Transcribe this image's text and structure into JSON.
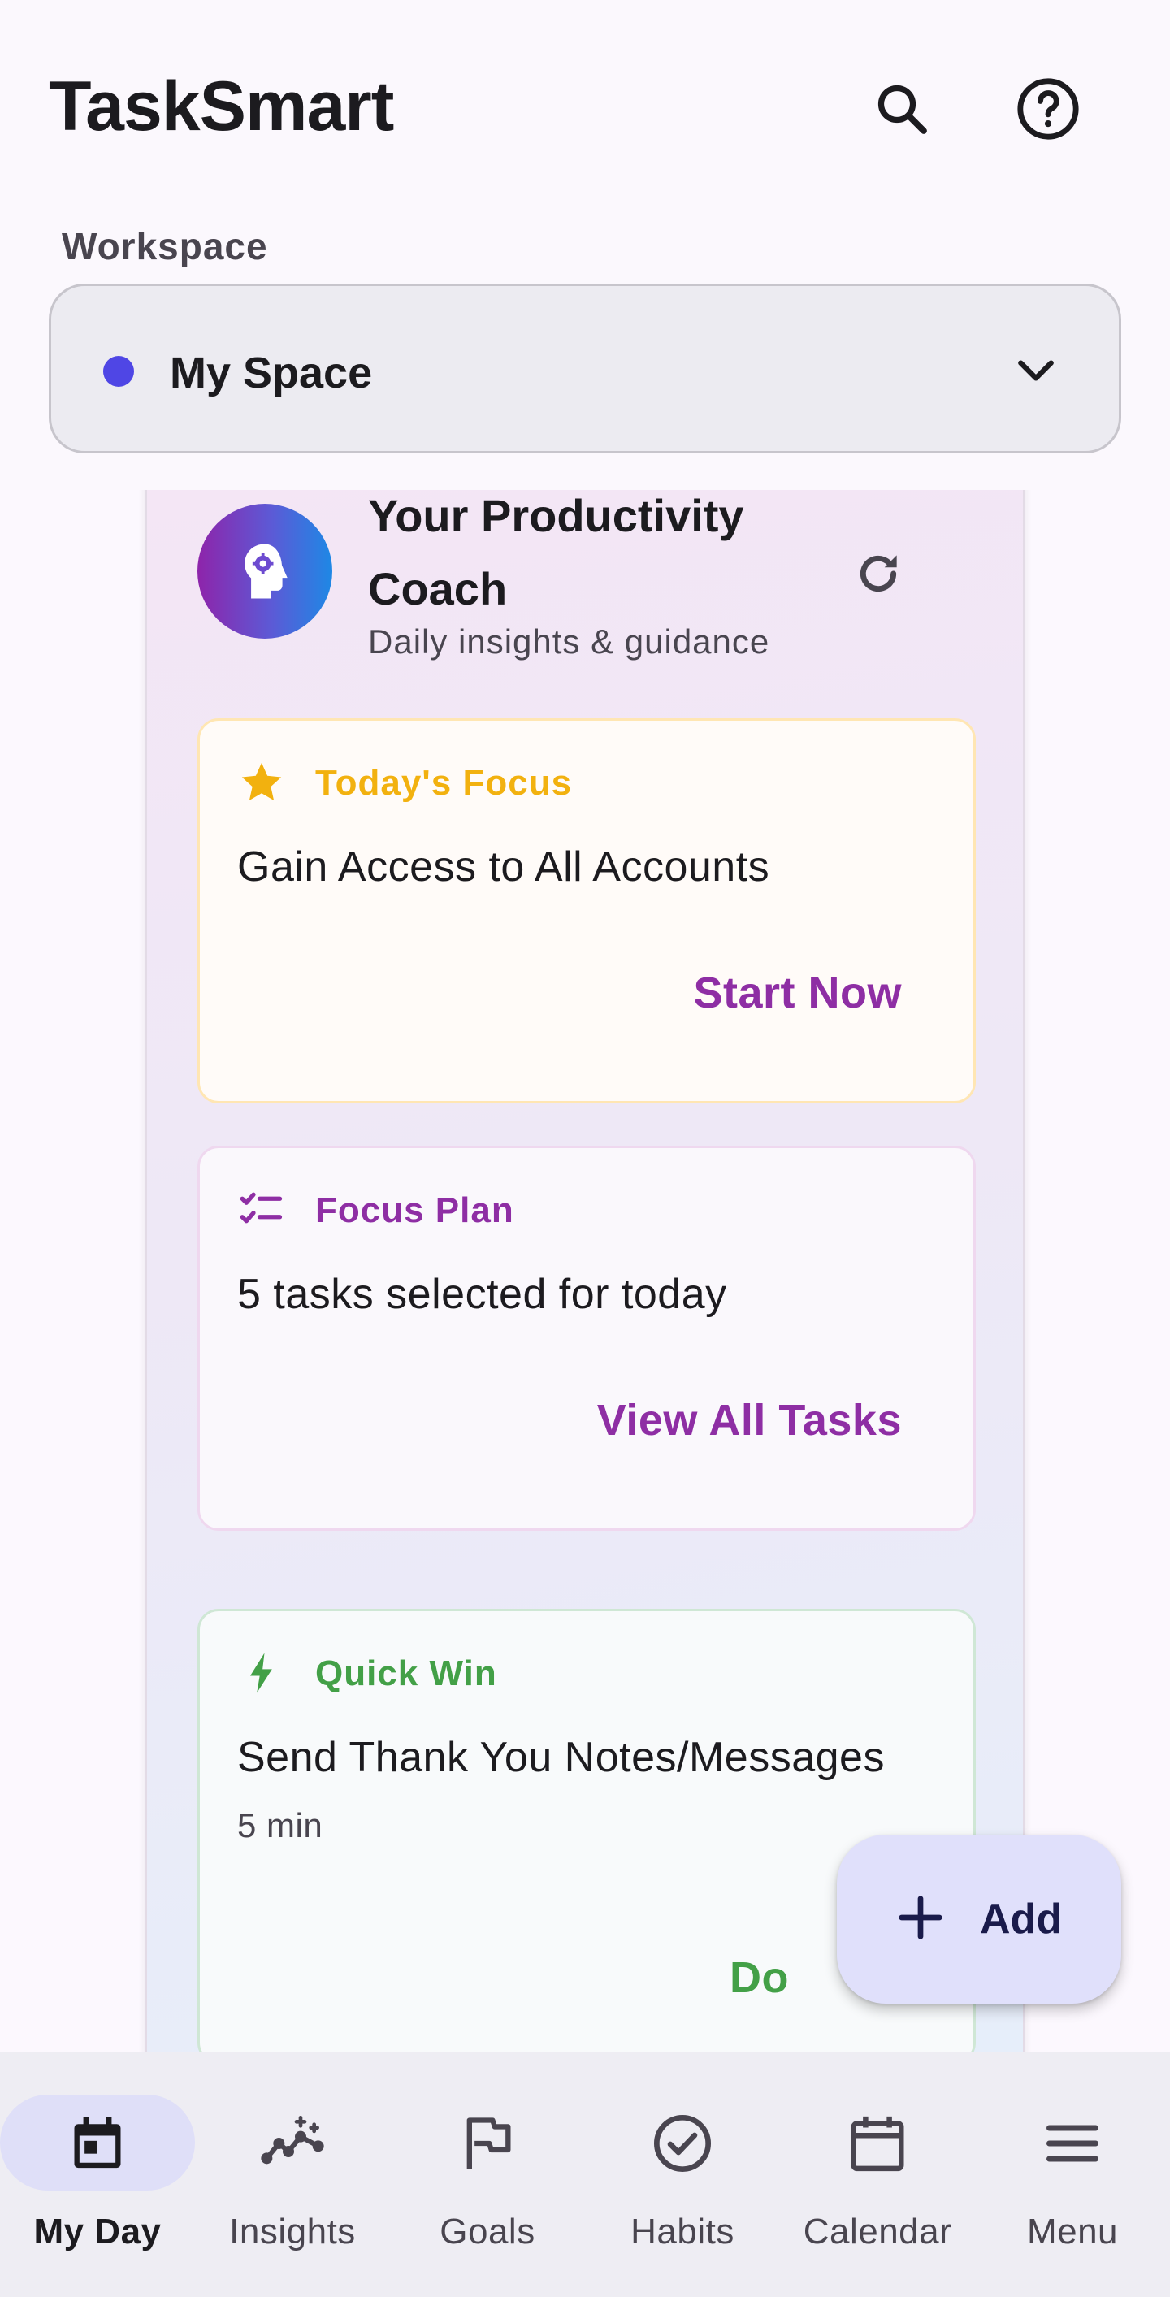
{
  "app": {
    "title": "TaskSmart"
  },
  "header": {
    "search_icon": "search-icon",
    "help_icon": "help-icon"
  },
  "workspace": {
    "label": "Workspace",
    "selected": "My Space",
    "dot_color": "#4f46e5"
  },
  "coach": {
    "title": "Your Productivity Coach",
    "subtitle": "Daily insights & guidance",
    "cards": [
      {
        "label": "Today's Focus",
        "text": "Gain Access to All Accounts",
        "action": "Start Now",
        "color": "#f2b10f",
        "icon": "star-icon"
      },
      {
        "label": "Focus Plan",
        "text": "5 tasks selected for today",
        "action": "View All Tasks",
        "color": "#8e2ea4",
        "icon": "checklist-icon"
      },
      {
        "label": "Quick Win",
        "text": "Send Thank You Notes/Messages",
        "sub": "5 min",
        "action": "Do",
        "color": "#43a047",
        "icon": "bolt-icon"
      }
    ]
  },
  "fab": {
    "label": "Add"
  },
  "nav": {
    "items": [
      {
        "label": "My Day",
        "icon": "calendar-today-icon",
        "active": true
      },
      {
        "label": "Insights",
        "icon": "insights-icon"
      },
      {
        "label": "Goals",
        "icon": "flag-icon"
      },
      {
        "label": "Habits",
        "icon": "check-circle-icon"
      },
      {
        "label": "Calendar",
        "icon": "calendar-icon"
      },
      {
        "label": "Menu",
        "icon": "menu-icon"
      }
    ]
  },
  "colors": {
    "accent": "#8e2ea4",
    "focus": "#f2b10f",
    "quick": "#43a047",
    "primary": "#4f46e5"
  }
}
